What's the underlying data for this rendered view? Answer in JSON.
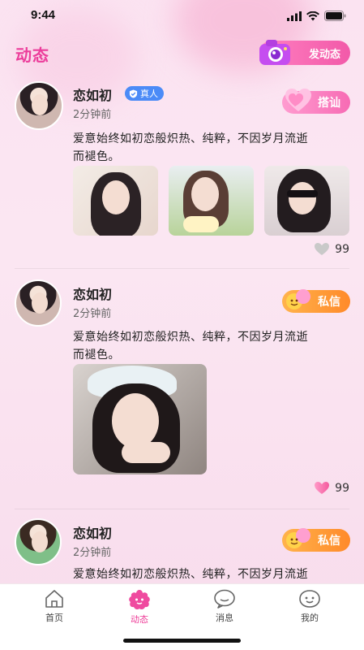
{
  "status": {
    "time": "9:44"
  },
  "header": {
    "title": "动态",
    "post_button": "发动态"
  },
  "posts": [
    {
      "username": "恋如初",
      "verified_label": "真人",
      "time": "2分钟前",
      "action": "搭讪",
      "text_line1": "爱意始终如初恋般炽热、纯粹，不因岁月流逝",
      "text_line2": "而褪色。",
      "likes": "99"
    },
    {
      "username": "恋如初",
      "time": "2分钟前",
      "action": "私信",
      "text_line1": "爱意始终如初恋般炽热、纯粹，不因岁月流逝",
      "text_line2": "而褪色。",
      "likes": "99"
    },
    {
      "username": "恋如初",
      "time": "2分钟前",
      "action": "私信",
      "text_line1": "爱意始终如初恋般炽热、纯粹，不因岁月流逝"
    }
  ],
  "tabs": [
    {
      "label": "首页",
      "icon": "home-icon"
    },
    {
      "label": "动态",
      "icon": "flower-icon"
    },
    {
      "label": "消息",
      "icon": "chat-icon"
    },
    {
      "label": "我的",
      "icon": "smile-icon"
    }
  ],
  "colors": {
    "accent": "#ec3d9b",
    "pink_button": "#f76bb4",
    "orange_button": "#ff8a2a",
    "verified": "#4b8bf7"
  }
}
